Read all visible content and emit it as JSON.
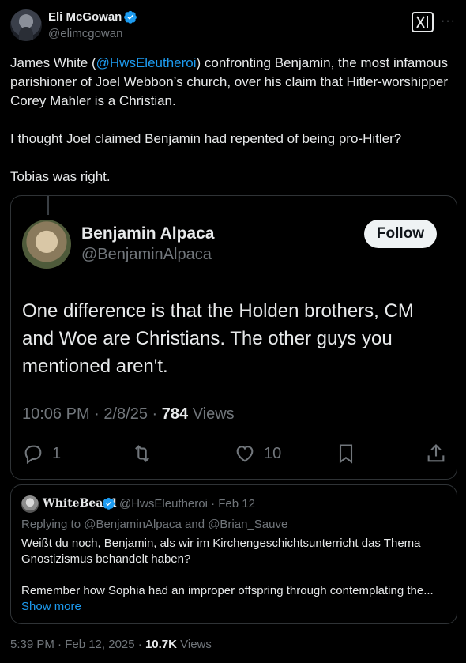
{
  "author": {
    "display_name": "Eli McGowan",
    "handle": "@elimcgowan",
    "verified_color": "#1d9bf0"
  },
  "tweet": {
    "text_before_mention": "James White (",
    "mention": "@HwsEleutheroi",
    "text_after_mention": ") confronting Benjamin, the most infamous parishioner of Joel Webbon’s church, over his claim that Hitler-worshipper Corey Mahler is a Christian.\n\nI thought Joel claimed Benjamin had repented of being pro-Hitler?\n\nTobias was right."
  },
  "media": {
    "display_name": "Benjamin Alpaca",
    "handle": "@BenjaminAlpaca",
    "follow_label": "Follow",
    "text": "One difference is that the Holden brothers, CM and Woe are Christians.  The other guys you mentioned aren't.",
    "time": "10:06 PM · 2/8/25 · ",
    "views_count": "784",
    "views_label": " Views",
    "replies": "1",
    "likes": "10"
  },
  "quote": {
    "display_name": "WhiteBeard",
    "handle_date": "@HwsEleutheroi · Feb 12",
    "replying_to": "Replying to @BenjaminAlpaca and @Brian_Sauve",
    "text_line1": "Weißt du noch, Benjamin, als wir im Kirchengeschichtsunterricht das Thema Gnostizismus behandelt haben?",
    "text_line2": "Remember how Sophia had an improper offspring through contemplating the...",
    "show_more": "Show more"
  },
  "footer": {
    "time": "5:39 PM · Feb 12, 2025 · ",
    "views_count": "10.7K",
    "views_label": " Views"
  }
}
